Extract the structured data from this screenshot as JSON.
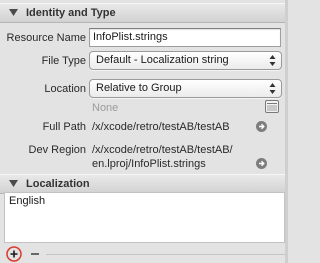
{
  "identity": {
    "header": "Identity and Type",
    "resource_name_label": "Resource Name",
    "resource_name_value": "InfoPlist.strings",
    "file_type_label": "File Type",
    "file_type_value": "Default - Localization string",
    "location_label": "Location",
    "location_value": "Relative to Group",
    "location_none": "None",
    "full_path_label": "Full Path",
    "full_path_value": "/x/xcode/retro/testAB/testAB",
    "dev_region_label": "Dev Region",
    "dev_region_line1": "/x/xcode/retro/testAB/testAB/",
    "dev_region_line2": "en.lproj/InfoPlist.strings"
  },
  "localization": {
    "header": "Localization",
    "items": [
      "English"
    ]
  },
  "icons": {
    "disclosure": "disclosure-triangle-down-icon",
    "folder": "folder-icon",
    "reveal": "reveal-arrow-icon",
    "add": "plus-icon",
    "remove": "minus-icon"
  },
  "colors": {
    "highlight": "#d93a2b"
  }
}
